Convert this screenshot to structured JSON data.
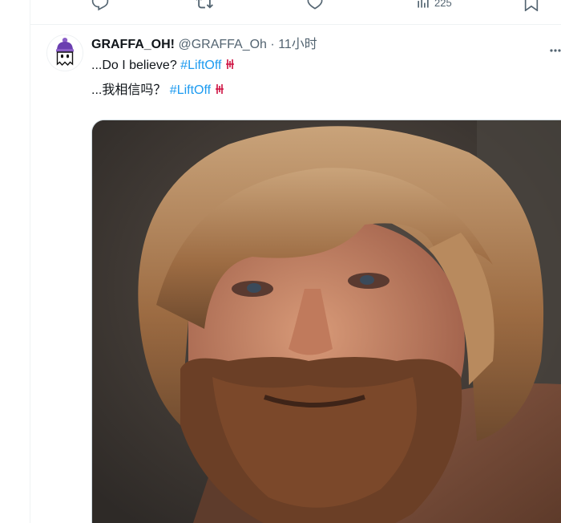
{
  "previous_tweet_actions": {
    "views_count": "225"
  },
  "tweet": {
    "display_name": "GRAFFA_OH!",
    "handle": "@GRAFFA_Oh",
    "separator": "·",
    "time": "11小时",
    "line1_text": "...Do I believe? ",
    "line1_hashtag": "#LiftOff",
    "line2_text": "...我相信吗？ ",
    "line2_hashtag": "#LiftOff",
    "colors": {
      "hashtag": "#1d9bf0",
      "secondary_text": "#536471",
      "rockets_red": "#ce1141"
    },
    "media_description_icon": "bearded-man-photo"
  }
}
